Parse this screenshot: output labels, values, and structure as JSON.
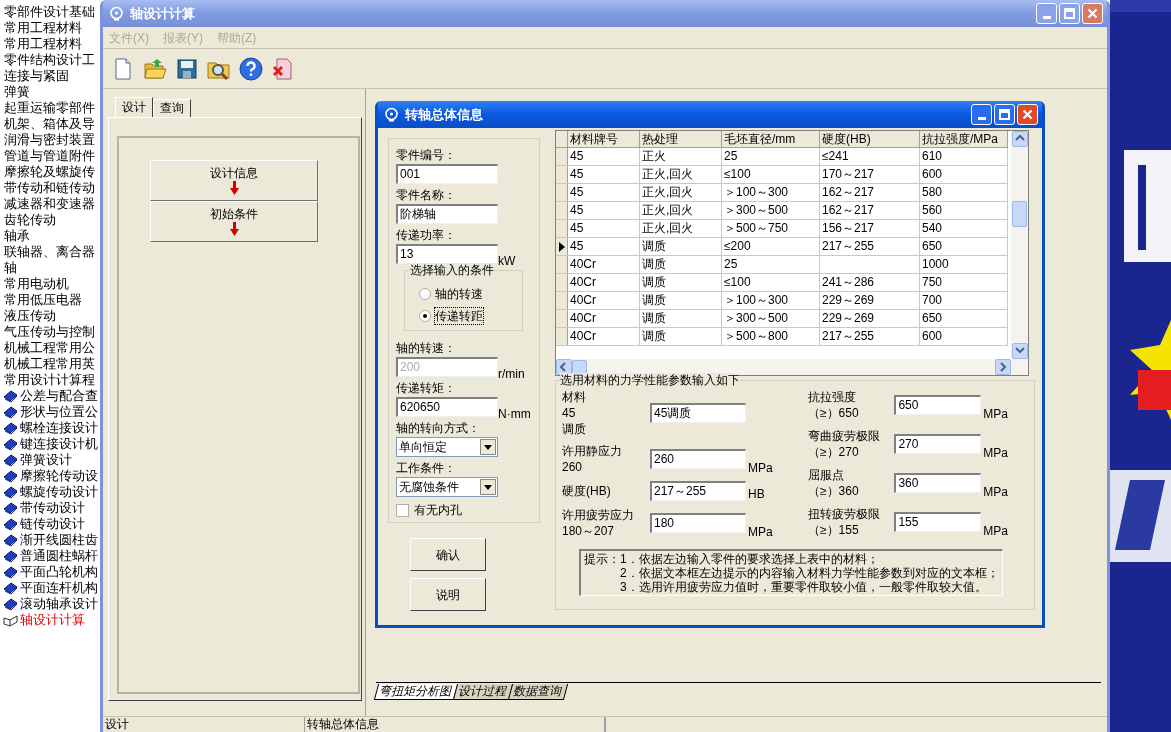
{
  "sidebar": {
    "items": [
      {
        "label": "零部件设计基础"
      },
      {
        "label": "常用工程材料"
      },
      {
        "label": "常用工程材料"
      },
      {
        "label": "零件结构设计工"
      },
      {
        "label": "连接与紧固"
      },
      {
        "label": "弹簧"
      },
      {
        "label": "起重运输零部件"
      },
      {
        "label": "机架、箱体及导"
      },
      {
        "label": "润滑与密封装置"
      },
      {
        "label": "管道与管道附件"
      },
      {
        "label": "摩擦轮及螺旋传"
      },
      {
        "label": "带传动和链传动"
      },
      {
        "label": "减速器和变速器"
      },
      {
        "label": "齿轮传动"
      },
      {
        "label": "轴承"
      },
      {
        "label": "联轴器、离合器"
      },
      {
        "label": "轴"
      },
      {
        "label": "常用电动机"
      },
      {
        "label": "常用低压电器"
      },
      {
        "label": "液压传动"
      },
      {
        "label": "气压传动与控制"
      },
      {
        "label": "机械工程常用公"
      },
      {
        "label": "机械工程常用英"
      },
      {
        "label": "常用设计计算程",
        "children": [
          {
            "label": "公差与配合查",
            "selected": false
          },
          {
            "label": "形状与位置公",
            "selected": false
          },
          {
            "label": "螺栓连接设计",
            "selected": false
          },
          {
            "label": "键连接设计机",
            "selected": false
          },
          {
            "label": "弹簧设计",
            "selected": false
          },
          {
            "label": "摩擦轮传动设",
            "selected": false
          },
          {
            "label": "螺旋传动设计",
            "selected": false
          },
          {
            "label": "带传动设计",
            "selected": false
          },
          {
            "label": "链传动设计",
            "selected": false
          },
          {
            "label": "渐开线圆柱齿",
            "selected": false
          },
          {
            "label": "普通圆柱蜗杆",
            "selected": false
          },
          {
            "label": "平面凸轮机构",
            "selected": false
          },
          {
            "label": "平面连杆机构",
            "selected": false
          },
          {
            "label": "滚动轴承设计",
            "selected": false
          },
          {
            "label": "轴设计计算",
            "selected": true
          }
        ]
      }
    ]
  },
  "main_window": {
    "title": "轴设计计算",
    "menu": [
      {
        "label": "文件(X)",
        "disabled": true
      },
      {
        "label": "报表(Y)",
        "disabled": true
      },
      {
        "label": "帮助(Z)",
        "disabled": true
      }
    ],
    "left_tabs": [
      {
        "label": "设计",
        "selected": true
      },
      {
        "label": "查询",
        "selected": false
      }
    ],
    "steps": [
      {
        "label": "设计信息"
      },
      {
        "label": "初始条件"
      }
    ],
    "bottom_tabs": [
      {
        "label": "弯扭矩分析图",
        "selected": true
      },
      {
        "label": "设计过程",
        "selected": false
      },
      {
        "label": "数据查询",
        "selected": false
      }
    ],
    "status_bar": [
      "设计",
      "转轴总体信息"
    ]
  },
  "dialog": {
    "title": "转轴总体信息",
    "fields": [
      {
        "kind": "text",
        "label": "零件编号：",
        "value": "001",
        "disabled": false
      },
      {
        "kind": "text",
        "label": "零件名称：",
        "value": "阶梯轴",
        "disabled": false
      },
      {
        "kind": "text",
        "label": "传递功率：",
        "value": "13",
        "unit": "kW",
        "disabled": false
      },
      {
        "kind": "radio_group",
        "label": "选择输入的条件",
        "options": [
          {
            "label": "轴的转速",
            "selected": false
          },
          {
            "label": "传递转距",
            "selected": true
          }
        ]
      },
      {
        "kind": "text",
        "label": "轴的转速：",
        "value": "200",
        "unit": "r/min",
        "disabled": true
      },
      {
        "kind": "text",
        "label": "传递转矩：",
        "value": "620650",
        "unit": "N·mm",
        "disabled": false
      },
      {
        "kind": "select",
        "label": "轴的转向方式：",
        "value": "单向恒定"
      },
      {
        "kind": "select",
        "label": "工作条件：",
        "value": "无腐蚀条件"
      },
      {
        "kind": "checkbox",
        "label": "有无内孔",
        "checked": false
      }
    ],
    "buttons": [
      "确认",
      "说明"
    ],
    "table": {
      "columns": [
        "材料牌号",
        "热处理",
        "毛坯直径/mm",
        "硬度(HB)",
        "抗拉强度/MPa"
      ],
      "rows": [
        {
          "cells": [
            "45",
            "正火",
            "25",
            "≤241",
            "610"
          ],
          "selected": false
        },
        {
          "cells": [
            "45",
            "正火,回火",
            "≤100",
            "170～217",
            "600"
          ],
          "selected": false
        },
        {
          "cells": [
            "45",
            "正火,回火",
            "＞100～300",
            "162～217",
            "580"
          ],
          "selected": false
        },
        {
          "cells": [
            "45",
            "正火,回火",
            "＞300～500",
            "162～217",
            "560"
          ],
          "selected": false
        },
        {
          "cells": [
            "45",
            "正火,回火",
            "＞500～750",
            "156～217",
            "540"
          ],
          "selected": false
        },
        {
          "cells": [
            "45",
            "调质",
            "≤200",
            "217～255",
            "650"
          ],
          "selected": true
        },
        {
          "cells": [
            "40Cr",
            "调质",
            "25",
            null,
            "1000"
          ],
          "selected": false
        },
        {
          "cells": [
            "40Cr",
            "调质",
            "≤100",
            "241～286",
            "750"
          ],
          "selected": false
        },
        {
          "cells": [
            "40Cr",
            "调质",
            "＞100～300",
            "229～269",
            "700"
          ],
          "selected": false
        },
        {
          "cells": [
            "40Cr",
            "调质",
            "＞300～500",
            "229～269",
            "650"
          ],
          "selected": false
        },
        {
          "cells": [
            "40Cr",
            "调质",
            "＞500～800",
            "217～255",
            "600"
          ],
          "selected": false
        }
      ]
    },
    "params": {
      "title": "选用材料的力学性能参数输入如下",
      "left": [
        {
          "label": "材料",
          "notes": [
            "45",
            "调质"
          ],
          "value": "45调质"
        },
        {
          "label": "许用静应力",
          "notes": [
            "260"
          ],
          "value": "260",
          "unit": "MPa"
        },
        {
          "label": "硬度(HB)",
          "value": "217～255",
          "unit": "HB"
        },
        {
          "label": "许用疲劳应力",
          "notes": [
            "180～207"
          ],
          "value": "180",
          "unit": "MPa"
        }
      ],
      "right": [
        {
          "label": "抗拉强度",
          "notes": [
            "（≥）650"
          ],
          "value": "650",
          "unit": "MPa"
        },
        {
          "label": "弯曲疲劳极限",
          "notes": [
            "（≥）270"
          ],
          "value": "270",
          "unit": "MPa"
        },
        {
          "label": "屈服点",
          "notes": [
            "（≥）360"
          ],
          "value": "360",
          "unit": "MPa"
        },
        {
          "label": "扭转疲劳极限",
          "notes": [
            "（≥）155"
          ],
          "value": "155",
          "unit": "MPa"
        }
      ]
    },
    "hint": [
      "提示：1．依据左边输入零件的要求选择上表中的材料；",
      "2．依据文本框左边提示的内容输入材料力学性能参数到对应的文本框；",
      "3．选用许用疲劳应力值时，重要零件取较小值，一般零件取较大值。"
    ]
  }
}
